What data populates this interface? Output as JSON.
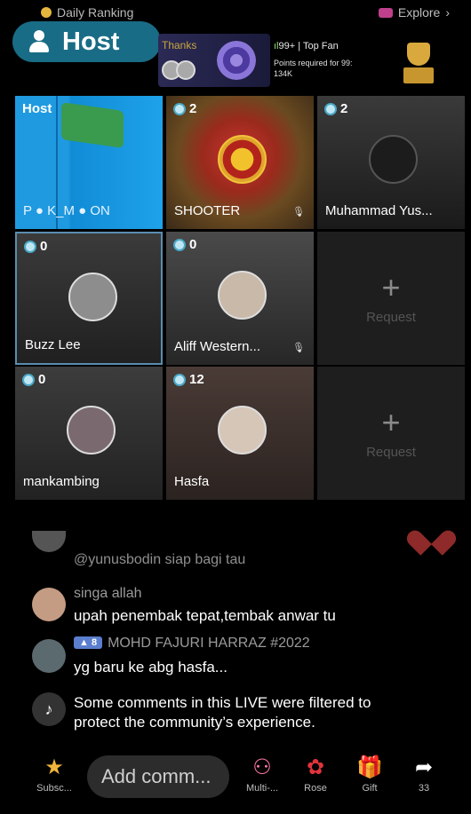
{
  "top": {
    "daily_ranking": "Daily Ranking",
    "explore": "Explore",
    "host_label": "Host",
    "banner_thanks": "Thanks",
    "fan_count": "99+",
    "top_fan": "Top Fan",
    "points_required": "Points required for 99:",
    "points_value": "134K"
  },
  "grid": {
    "host_tag": "Host",
    "cells": [
      {
        "name": "P ● K_M ● ON"
      },
      {
        "count": "2",
        "name": "SHOOTER"
      },
      {
        "count": "2",
        "name": "Muhammad Yus..."
      },
      {
        "count": "0",
        "name": "Buzz Lee"
      },
      {
        "count": "0",
        "name": "Aliff Western..."
      },
      {
        "plus": "+",
        "request": "Request"
      },
      {
        "count": "0",
        "name": "mankambing"
      },
      {
        "count": "12",
        "name": "Hasfa"
      },
      {
        "plus": "+",
        "request": "Request"
      }
    ]
  },
  "comments": [
    {
      "user": "@yunusbodin siap bagi tau",
      "text": ""
    },
    {
      "user": "singa allah",
      "text": "upah penembak tepat,tembak anwar tu"
    },
    {
      "level": "8",
      "user": "MOHD FAJURI HARRAZ #2022",
      "text": "yg baru ke abg hasfa..."
    },
    {
      "text": "Some comments in this LIVE were filtered to",
      "text2": "protect the community’s experience."
    }
  ],
  "bottom": {
    "subscribe": "Subsc...",
    "add_comment_placeholder": "Add comm...",
    "multi": "Multi-...",
    "rose": "Rose",
    "gift": "Gift",
    "share_count": "33"
  }
}
